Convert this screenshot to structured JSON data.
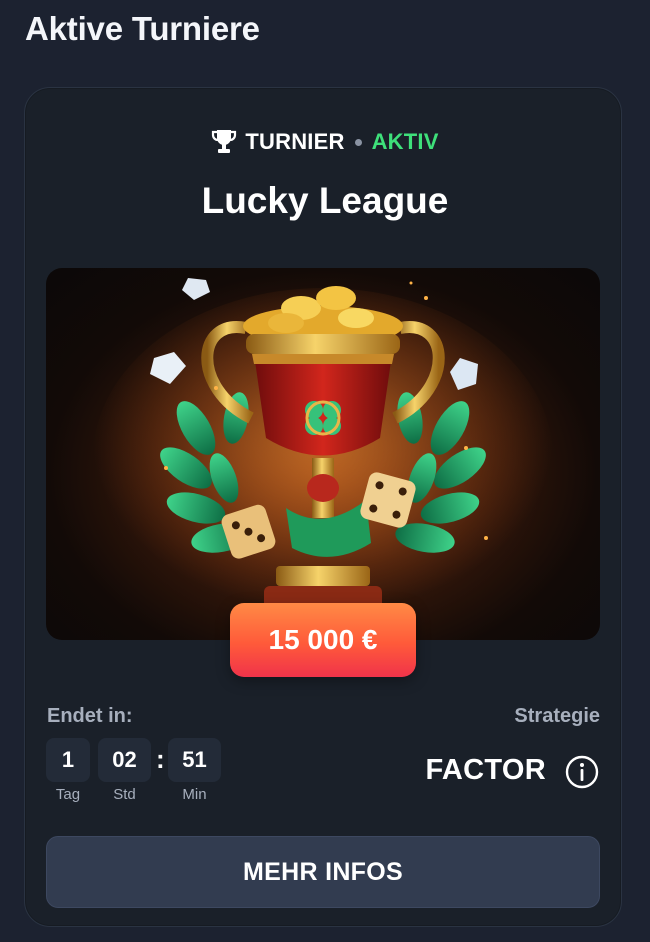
{
  "section_title": "Aktive Turniere",
  "tournament": {
    "type_label": "TURNIER",
    "status_label": "AKTIV",
    "name": "Lucky League",
    "prize": "15 000 €",
    "ends_label": "Endet in:",
    "countdown": [
      {
        "value": "1",
        "unit": "Tag"
      },
      {
        "value": "02",
        "unit": "Std"
      },
      {
        "value": "51",
        "unit": "Min"
      }
    ],
    "countdown_separator": ":",
    "strategy_label": "Strategie",
    "strategy_value": "FACTOR",
    "button_label": "MEHR INFOS"
  },
  "icons": {
    "status": "trophy-icon",
    "strategy_info": "info-icon",
    "banner": "golden-trophy-illustration"
  },
  "colors": {
    "background": "#1c2230",
    "card": "#1a2029",
    "active_status": "#3ee07a",
    "prize_gradient_top": "#ff8a45",
    "prize_gradient_bottom": "#f0334a",
    "button": "#323c50",
    "muted_text": "#a7afbd"
  }
}
